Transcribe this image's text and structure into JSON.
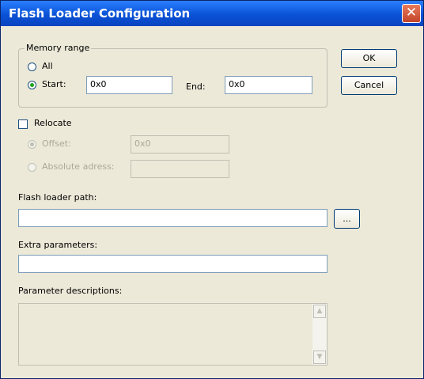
{
  "window": {
    "title": "Flash Loader Configuration"
  },
  "icons": {
    "close": "close-icon",
    "scroll_up": "scroll-up-icon",
    "scroll_down": "scroll-down-icon"
  },
  "memory_range": {
    "legend": "Memory range",
    "all_label": "All",
    "start_label": "Start:",
    "start_value": "0x0",
    "end_label": "End:",
    "end_value": "0x0",
    "selected": "start"
  },
  "buttons": {
    "ok": "OK",
    "cancel": "Cancel",
    "browse": "..."
  },
  "relocate": {
    "label": "Relocate",
    "checked": false,
    "offset_label": "Offset:",
    "offset_value": "0x0",
    "absolute_label": "Absolute adress:",
    "absolute_value": ""
  },
  "flash_loader_path": {
    "label": "Flash loader path:",
    "value": ""
  },
  "extra_parameters": {
    "label": "Extra parameters:",
    "value": ""
  },
  "parameter_descriptions": {
    "label": "Parameter descriptions:",
    "value": ""
  },
  "colors": {
    "titlebar": "#0a52d6",
    "dialog_bg": "#ece9d8",
    "close_bg": "#d7533a"
  }
}
